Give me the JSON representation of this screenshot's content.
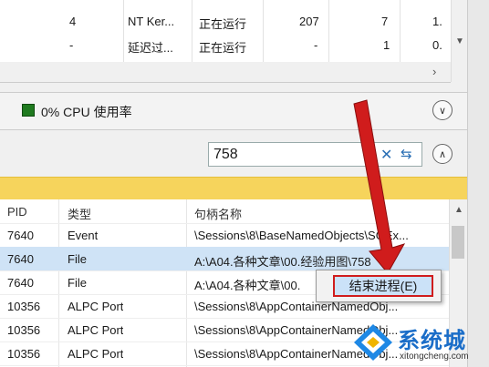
{
  "process_rows": [
    {
      "pid": "4",
      "name": "NT Ker...",
      "status": "正在运行",
      "threads": "207",
      "cpu": "7",
      "extra": "1."
    },
    {
      "pid": "-",
      "name": "延迟过...",
      "status": "正在运行",
      "threads": "-",
      "cpu": "1",
      "extra": "0."
    }
  ],
  "cpu": {
    "label": "0% CPU 使用率",
    "indicator_color": "#1f7a1f"
  },
  "search": {
    "value": "758"
  },
  "handles": {
    "headers": [
      "PID",
      "类型",
      "句柄名称"
    ],
    "rows": [
      {
        "pid": "7640",
        "type": "Event",
        "name": "\\Sessions\\8\\BaseNamedObjects\\SGEx..."
      },
      {
        "pid": "7640",
        "type": "File",
        "name": "A:\\A04.各种文章\\00.经验用图\\758"
      },
      {
        "pid": "7640",
        "type": "File",
        "name": "A:\\A04.各种文章\\00."
      },
      {
        "pid": "10356",
        "type": "ALPC Port",
        "name": "\\Sessions\\8\\AppContainerNamedObj..."
      },
      {
        "pid": "10356",
        "type": "ALPC Port",
        "name": "\\Sessions\\8\\AppContainerNamedObj..."
      },
      {
        "pid": "10356",
        "type": "ALPC Port",
        "name": "\\Sessions\\8\\AppContainerNamedObj..."
      }
    ]
  },
  "context_menu": {
    "item": "结束进程(E)"
  },
  "watermark": {
    "text": "系统城",
    "sub": "xitongcheng.com"
  },
  "colors": {
    "highlight": "#d01c1c",
    "selection": "#cfe3f6",
    "yellow_bar": "#f6d45c"
  }
}
